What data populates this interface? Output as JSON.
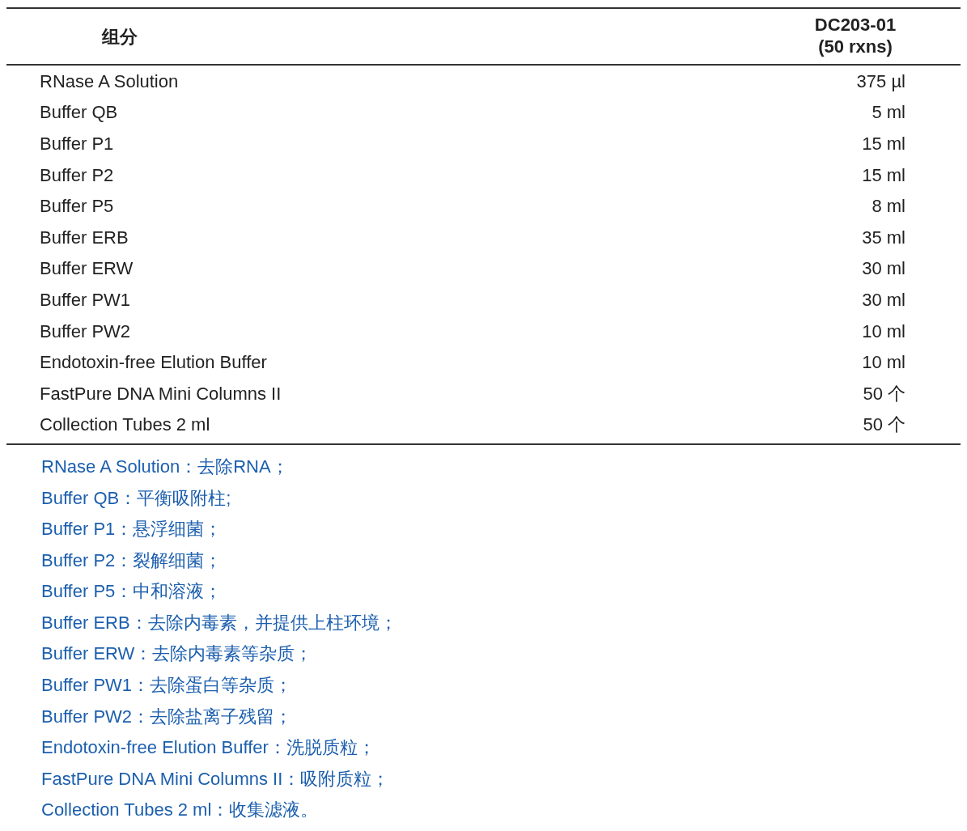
{
  "table": {
    "columns": [
      {
        "lines": [
          "组分"
        ]
      },
      {
        "lines": [
          "DC203-01",
          "(50 rxns)"
        ]
      }
    ],
    "rows": [
      {
        "component": "RNase A Solution",
        "amount": "375 µl"
      },
      {
        "component": "Buffer QB",
        "amount": "5 ml"
      },
      {
        "component": "Buffer P1",
        "amount": "15 ml"
      },
      {
        "component": "Buffer P2",
        "amount": "15 ml"
      },
      {
        "component": "Buffer P5",
        "amount": "8 ml"
      },
      {
        "component": "Buffer ERB",
        "amount": "35 ml"
      },
      {
        "component": "Buffer ERW",
        "amount": "30 ml"
      },
      {
        "component": "Buffer PW1",
        "amount": "30 ml"
      },
      {
        "component": "Buffer PW2",
        "amount": "10 ml"
      },
      {
        "component": "Endotoxin-free Elution Buffer",
        "amount": "10 ml"
      },
      {
        "component": "FastPure DNA Mini Columns II",
        "amount": "50 个"
      },
      {
        "component": "Collection Tubes 2 ml",
        "amount": "50 个"
      }
    ]
  },
  "notes": [
    "RNase A Solution：去除RNA；",
    "Buffer QB：平衡吸附柱;",
    "Buffer P1：悬浮细菌；",
    "Buffer P2：裂解细菌；",
    "Buffer P5：中和溶液；",
    "Buffer ERB：去除内毒素，并提供上柱环境；",
    "Buffer ERW：去除内毒素等杂质；",
    "Buffer PW1：去除蛋白等杂质；",
    "Buffer PW2：去除盐离子残留；",
    "Endotoxin-free Elution Buffer：洗脱质粒；",
    "FastPure DNA Mini Columns II：吸附质粒；",
    "Collection Tubes 2 ml：收集滤液。"
  ]
}
